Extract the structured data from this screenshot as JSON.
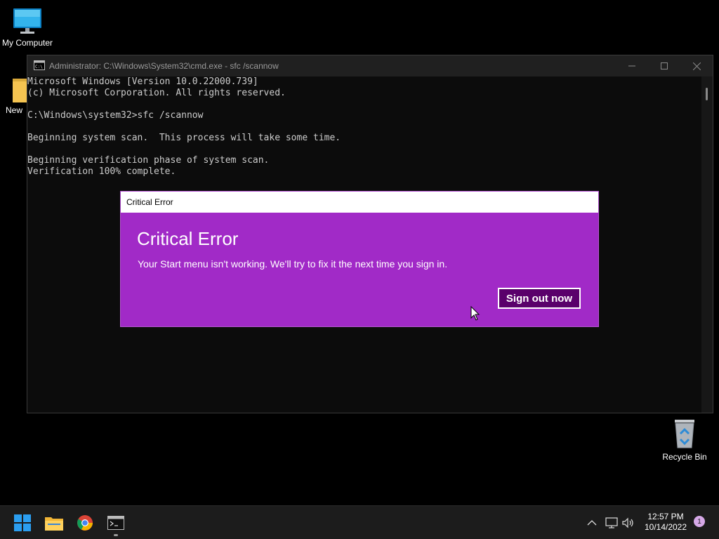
{
  "desktop": {
    "icons": {
      "my_computer": "My Computer",
      "new_folder": "New",
      "recycle_bin": "Recycle Bin"
    }
  },
  "cmd": {
    "title": "Administrator: C:\\Windows\\System32\\cmd.exe - sfc  /scannow",
    "lines": [
      "Microsoft Windows [Version 10.0.22000.739]",
      "(c) Microsoft Corporation. All rights reserved.",
      "",
      "C:\\Windows\\system32>sfc /scannow",
      "",
      "Beginning system scan.  This process will take some time.",
      "",
      "Beginning verification phase of system scan.",
      "Verification 100% complete."
    ]
  },
  "dialog": {
    "window_title": "Critical Error",
    "heading": "Critical Error",
    "message": "Your Start menu isn't working. We'll try to fix it the next time you sign in.",
    "button_label": "Sign out now",
    "accent_color": "#a12ac7",
    "button_color": "#5a006b"
  },
  "taskbar": {
    "apps": [
      "start-icon",
      "file-explorer-icon",
      "chrome-icon",
      "terminal-icon"
    ],
    "time": "12:57 PM",
    "date": "10/14/2022",
    "notification_count": "1"
  }
}
